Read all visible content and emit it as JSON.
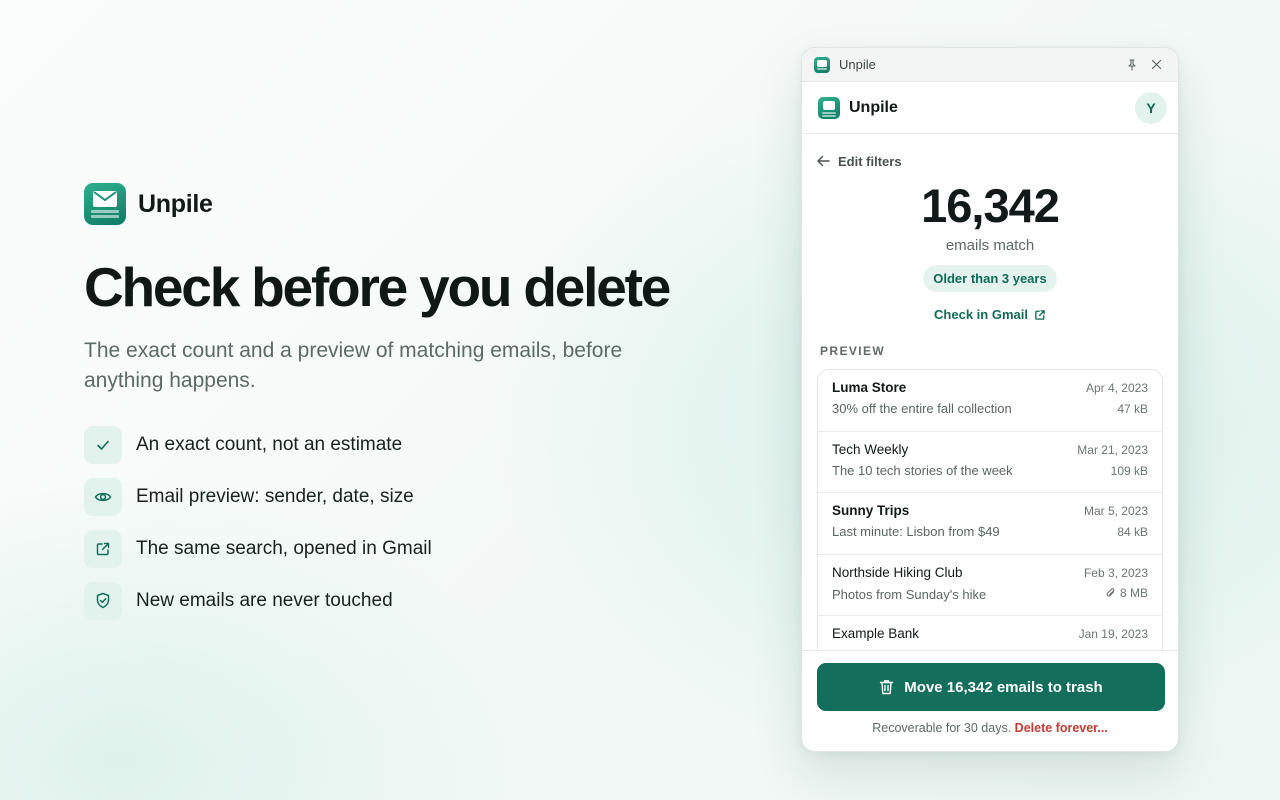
{
  "brand": {
    "name": "Unpile"
  },
  "hero": {
    "title": "Check before you delete",
    "subtitle": "The exact count and a preview of matching emails, before anything happens.",
    "features": [
      {
        "icon": "check-icon",
        "label": "An exact count, not an estimate"
      },
      {
        "icon": "eye-icon",
        "label": "Email preview: sender, date, size"
      },
      {
        "icon": "external-link-icon",
        "label": "The same search, opened in Gmail"
      },
      {
        "icon": "shield-check-icon",
        "label": "New emails are never touched"
      }
    ]
  },
  "window": {
    "title": "Unpile",
    "app_title": "Unpile",
    "avatar_initial": "Y",
    "back_label": "Edit filters",
    "count": "16,342",
    "count_label": "emails match",
    "filter_chip": "Older than 3 years",
    "gmail_link": "Check in Gmail",
    "preview_heading": "PREVIEW",
    "emails": [
      {
        "sender": "Luma Store",
        "date": "Apr 4, 2023",
        "subject": "30% off the entire fall collection",
        "size": "47 kB",
        "unread": true,
        "attachment": false
      },
      {
        "sender": "Tech Weekly",
        "date": "Mar 21, 2023",
        "subject": "The 10 tech stories of the week",
        "size": "109 kB",
        "unread": false,
        "attachment": false
      },
      {
        "sender": "Sunny Trips",
        "date": "Mar 5, 2023",
        "subject": "Last minute: Lisbon from $49",
        "size": "84 kB",
        "unread": true,
        "attachment": false
      },
      {
        "sender": "Northside Hiking Club",
        "date": "Feb 3, 2023",
        "subject": "Photos from Sunday's hike",
        "size": "8 MB",
        "unread": false,
        "attachment": true
      },
      {
        "sender": "Example Bank",
        "date": "Jan 19, 2023",
        "subject": "",
        "size": "",
        "unread": false,
        "attachment": false
      }
    ],
    "trash_button": "Move 16,342 emails to trash",
    "footnote": "Recoverable for 30 days.",
    "delete_forever": "Delete forever..."
  },
  "colors": {
    "accent": "#136e5b",
    "accent_light": "#e2f2ec",
    "danger": "#c23b32"
  }
}
